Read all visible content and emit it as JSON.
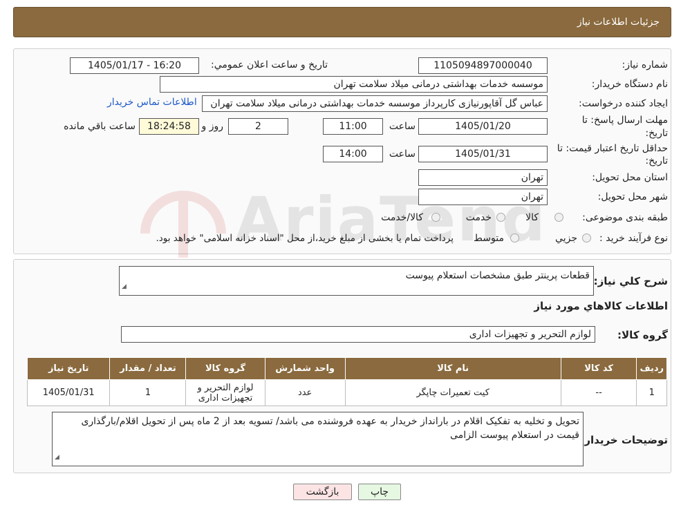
{
  "header": {
    "title": "جزئیات اطلاعات نیاز"
  },
  "form": {
    "need_number_label": "شماره نیاز:",
    "need_number": "1105094897000040",
    "announce_label": "تاریخ و ساعت اعلان عمومي:",
    "announce_value": "1405/01/17 - 16:20",
    "buyer_org_label": "نام دستگاه خریدار:",
    "buyer_org": "موسسه خدمات بهداشتی درمانی میلاد سلامت تهران",
    "requester_label": "ایجاد کننده درخواست:",
    "requester": "عباس گل آقاپورنیازی کارپرداز موسسه خدمات بهداشتی درمانی میلاد سلامت تهران",
    "contact_link": "اطلاعات تماس خریدار",
    "reply_deadline_label_1": "مهلت ارسال پاسخ: تا",
    "reply_deadline_label_2": "تاریخ:",
    "reply_date": "1405/01/20",
    "time_label": "ساعت",
    "reply_time": "11:00",
    "days_value": "2",
    "days_label": "روز و",
    "remaining_time": "18:24:58",
    "remaining_label": "ساعت باقي مانده",
    "price_validity_label_1": "حداقل تاریخ اعتبار قیمت: تا",
    "price_validity_label_2": "تاریخ:",
    "price_date": "1405/01/31",
    "price_time": "14:00",
    "province_label": "استان محل تحویل:",
    "province": "تهران",
    "city_label": "شهر محل تحویل:",
    "city": "تهران",
    "category_label": "طبقه بندی موضوعی:",
    "category_options": [
      "کالا",
      "خدمت",
      "کالا/خدمت"
    ],
    "process_label": "نوع فرآیند خرید :",
    "process_options": [
      "جزیي",
      "متوسط"
    ],
    "process_note": "پرداخت تمام یا بخشی از مبلغ خرید،از محل \"اسناد خزانه اسلامی\" خواهد بود."
  },
  "details": {
    "description_label": "شرح کلي نیاز:",
    "description": "قطعات پرینتر طبق مشخصات استعلام پیوست",
    "goods_info_title": "اطلاعات کالاهاي مورد نیاز",
    "group_label": "گروه کالا:",
    "group_value": "لوازم التحریر و تجهیزات اداری",
    "table": {
      "headers": [
        "ردیف",
        "کد کالا",
        "نام کالا",
        "واحد شمارش",
        "گروه کالا",
        "تعداد / مقدار",
        "تاریخ نیاز"
      ],
      "rows": [
        [
          "1",
          "--",
          "کیت تعمیرات چاپگر",
          "عدد",
          "لوازم التحریر و تجهیزات اداری",
          "1",
          "1405/01/31"
        ]
      ]
    },
    "buyer_notes_label": "توضیحات خریدار:",
    "buyer_notes": "تحویل و تخلیه به تفکیک اقلام در بارانداز خریدار به عهده فروشنده می باشد/ تسویه بعد از 2 ماه پس از تحویل اقلام/بارگذاری قیمت در استعلام پیوست الزامی"
  },
  "buttons": {
    "print": "چاپ",
    "back": "بازگشت"
  },
  "watermark": {
    "text": "AriaTender.neT"
  },
  "colors": {
    "header": "#8a6a3e",
    "link": "#1d59c9",
    "watermark": "#c62828"
  }
}
